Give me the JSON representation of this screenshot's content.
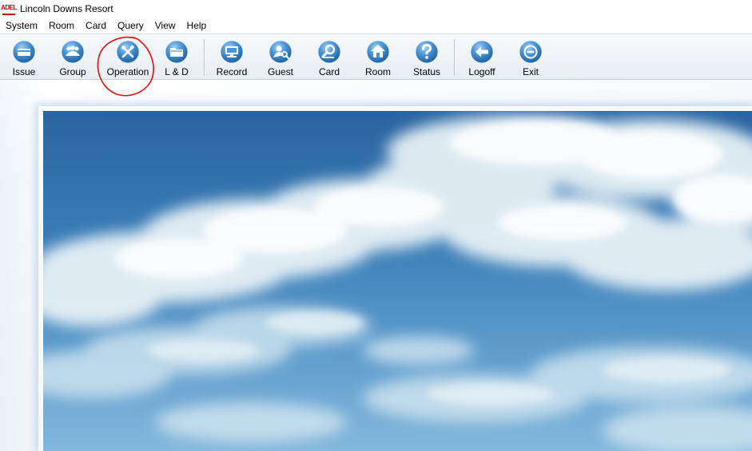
{
  "window": {
    "title": "Lincoln Downs Resort",
    "logo_text": "ADEL"
  },
  "menu": [
    {
      "label": "System"
    },
    {
      "label": "Room"
    },
    {
      "label": "Card"
    },
    {
      "label": "Query"
    },
    {
      "label": "View"
    },
    {
      "label": "Help"
    }
  ],
  "toolbar": {
    "buttons": [
      {
        "label": "Issue",
        "icon": "card-issue-icon"
      },
      {
        "label": "Group",
        "icon": "group-icon"
      },
      {
        "label": "Operation",
        "icon": "tools-icon"
      },
      {
        "label": "L & D",
        "icon": "folder-icon"
      },
      {
        "label": "Record",
        "icon": "monitor-icon"
      },
      {
        "label": "Guest",
        "icon": "guest-icon"
      },
      {
        "label": "Card",
        "icon": "card-search-icon"
      },
      {
        "label": "Room",
        "icon": "home-icon"
      },
      {
        "label": "Status",
        "icon": "help-icon"
      },
      {
        "label": "Logoff",
        "icon": "back-arrow-icon"
      },
      {
        "label": "Exit",
        "icon": "minus-circle-icon"
      }
    ]
  },
  "colors": {
    "logo_red": "#d00000",
    "icon_blue_dark": "#1f5f9e",
    "icon_blue_light": "#5aa0dc",
    "annotation_red": "#e01010",
    "sky_top": "#2f6ea6",
    "sky_bottom": "#7fb3d8"
  },
  "annotation": {
    "target": "Operation",
    "shape": "hand-drawn-circle"
  }
}
